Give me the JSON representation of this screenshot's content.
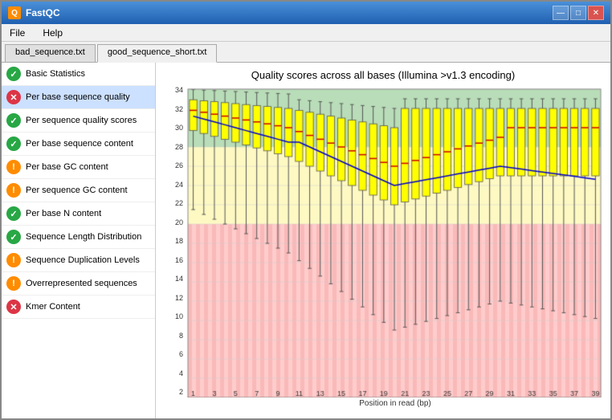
{
  "window": {
    "title": "FastQC",
    "icon": "Q"
  },
  "titleControls": {
    "minimize": "—",
    "maximize": "□",
    "close": "✕"
  },
  "menu": {
    "items": [
      "File",
      "Help"
    ]
  },
  "tabs": [
    {
      "label": "bad_sequence.txt",
      "active": false
    },
    {
      "label": "good_sequence_short.txt",
      "active": true
    }
  ],
  "sidebar": {
    "items": [
      {
        "label": "Basic Statistics",
        "status": "ok",
        "active": false
      },
      {
        "label": "Per base sequence quality",
        "status": "fail",
        "active": true
      },
      {
        "label": "Per sequence quality scores",
        "status": "ok",
        "active": false
      },
      {
        "label": "Per base sequence content",
        "status": "ok",
        "active": false
      },
      {
        "label": "Per base GC content",
        "status": "warn",
        "active": false
      },
      {
        "label": "Per sequence GC content",
        "status": "warn",
        "active": false
      },
      {
        "label": "Per base N content",
        "status": "ok",
        "active": false
      },
      {
        "label": "Sequence Length Distribution",
        "status": "ok",
        "active": false
      },
      {
        "label": "Sequence Duplication Levels",
        "status": "warn",
        "active": false
      },
      {
        "label": "Overrepresented sequences",
        "status": "warn",
        "active": false
      },
      {
        "label": "Kmer Content",
        "status": "fail",
        "active": false
      }
    ]
  },
  "chart": {
    "title": "Quality scores across all bases (Illumina >v1.3 encoding)",
    "xAxisLabel": "Position in read (bp)",
    "yMin": 2,
    "yMax": 34,
    "xLabels": [
      "1",
      "3",
      "5",
      "7",
      "9",
      "11",
      "13",
      "15",
      "17",
      "19",
      "21",
      "23",
      "25",
      "27",
      "29",
      "31",
      "33",
      "35",
      "37",
      "39"
    ],
    "colors": {
      "bgGreen": "#a8d8a8",
      "bgYellow": "#fffacd",
      "bgRed": "#ffb3b3",
      "boxFill": "#ffff00",
      "boxBorder": "#333",
      "medianLine": "#ff0000",
      "meanLine": "#0000ff",
      "whisker": "#333",
      "stripeRed": "rgba(255,100,100,0.3)"
    }
  }
}
